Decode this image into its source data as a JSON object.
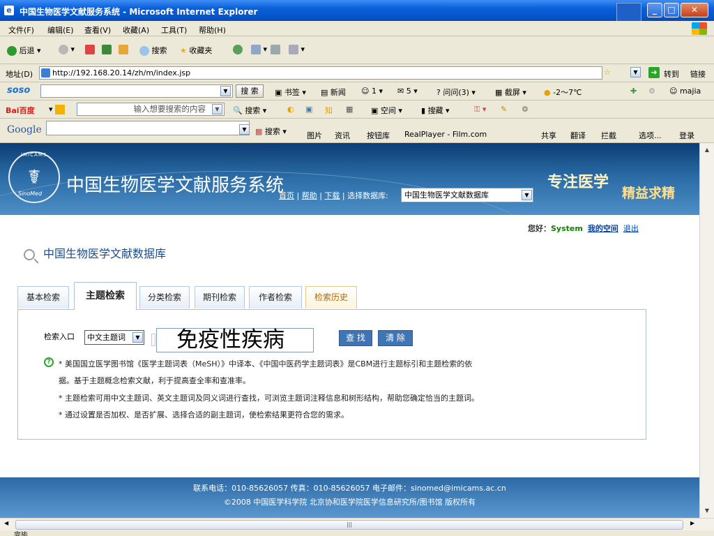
{
  "window": {
    "title": "中国生物医学文献服务系统 - Microsoft Internet Explorer"
  },
  "menu": [
    "文件(F)",
    "编辑(E)",
    "查看(V)",
    "收藏(A)",
    "工具(T)",
    "帮助(H)"
  ],
  "nav": {
    "back": "后退",
    "search": "搜索",
    "favorites": "收藏夹"
  },
  "address": {
    "label": "地址(D)",
    "url": "http://192.168.20.14/zh/m/index.jsp",
    "go": "转到",
    "links": "链接"
  },
  "soso": {
    "brand": "soso",
    "search_btn": "搜 索",
    "bookmark": "书签",
    "news": "新闻",
    "count1": "1",
    "count5": "5",
    "wenwen": "问问(3)",
    "screenshot": "截屏",
    "weather": "-2～7℃",
    "user": "majia"
  },
  "baidu": {
    "brand": "Bai百度",
    "placeholder": "输入想要搜索的内容",
    "search": "搜索",
    "space": "空间",
    "collect": "搜藏"
  },
  "google": {
    "brand": "Google",
    "search": "搜索",
    "images": "图片",
    "news": "资讯",
    "buttons": "按钮库",
    "realplayer": "RealPlayer - Film.com",
    "share": "共享",
    "translate": "翻译",
    "block": "拦截",
    "options": "选项...",
    "login": "登录"
  },
  "site": {
    "name": "中国生物医学文献服务系统",
    "slogan_a": "专注医学",
    "slogan_b": "精益求精",
    "links": {
      "home": "首页",
      "help": "帮助",
      "download": "下载",
      "select_label": "选择数据库:"
    },
    "db_selected": "中国生物医学文献数据库"
  },
  "user": {
    "greeting": "您好：",
    "name": "System",
    "myspace": "我的空间",
    "logout": "退出"
  },
  "page_title": "中国生物医学文献数据库",
  "tabs": [
    "基本检索",
    "主题检索",
    "分类检索",
    "期刊检索",
    "作者检索",
    "检索历史"
  ],
  "form": {
    "entry_label": "检索入口",
    "entry_value": "中文主题词",
    "query": "免疫性疾病",
    "find": "查 找",
    "clear": "清 除"
  },
  "notes": [
    "* 美国国立医学图书馆《医学主题词表（MeSH）》中译本、《中国中医药学主题词表》是CBM进行主题标引和主题检索的依",
    "据。基于主题概念检索文献，利于提高查全率和查准率。",
    "* 主题检索可用中文主题词、英文主题词及同义词进行查找，可浏览主题词注释信息和树形结构，帮助您确定恰当的主题词。",
    "* 通过设置是否加权、是否扩展、选择合适的副主题词，使检索结果更符合您的需求。"
  ],
  "footer": {
    "line1": "联系电话：010-85626057   传真：010-85626057   电子邮件：sinomed@imicams.ac.cn",
    "line2": "©2008 中国医学科学院 北京协和医学院医学信息研究所/图书馆 版权所有"
  },
  "status": {
    "text": "完毕"
  }
}
